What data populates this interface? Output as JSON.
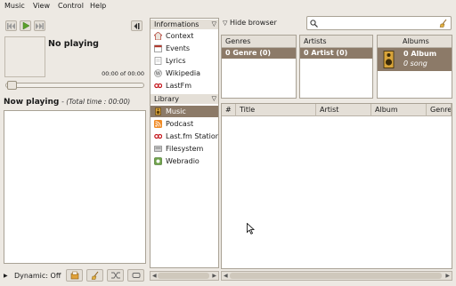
{
  "menubar": {
    "items": [
      {
        "label": "Music"
      },
      {
        "label": "View"
      },
      {
        "label": "Control"
      },
      {
        "label": "Help"
      }
    ]
  },
  "player": {
    "title": "No playing",
    "time": "00:00 of 00:00",
    "progress": 0
  },
  "now_playing": {
    "label": "Now playing",
    "total": "- (Total time : 00:00)"
  },
  "dynamic": {
    "label": "Dynamic: Off"
  },
  "side_panel": {
    "informations_header": "Informations",
    "info_items": [
      {
        "label": "Context",
        "icon": "home-icon"
      },
      {
        "label": "Events",
        "icon": "events-icon"
      },
      {
        "label": "Lyrics",
        "icon": "lyrics-icon"
      },
      {
        "label": "Wikipedia",
        "icon": "wikipedia-icon"
      },
      {
        "label": "LastFm",
        "icon": "lastfm-icon"
      }
    ],
    "library_header": "Library",
    "library_items": [
      {
        "label": "Music",
        "icon": "speaker-icon",
        "selected": true
      },
      {
        "label": "Podcast",
        "icon": "rss-icon"
      },
      {
        "label": "Last.fm Station",
        "icon": "lastfm-icon"
      },
      {
        "label": "Filesystem",
        "icon": "filesystem-icon"
      },
      {
        "label": "Webradio",
        "icon": "webradio-icon"
      }
    ]
  },
  "browser": {
    "hide_label": "Hide browser",
    "search_placeholder": "",
    "columns": [
      {
        "header": "Genres",
        "row": "0 Genre (0)"
      },
      {
        "header": "Artists",
        "row": "0 Artist (0)"
      },
      {
        "header": "Albums",
        "row": "0 Album",
        "sub": "0 song"
      }
    ]
  },
  "tracks": {
    "headers": [
      "#",
      "Title",
      "Artist",
      "Album",
      "Genre"
    ]
  },
  "colors": {
    "selection": "#8c7a68",
    "background": "#ede9e3",
    "header": "#e4dfd7"
  }
}
